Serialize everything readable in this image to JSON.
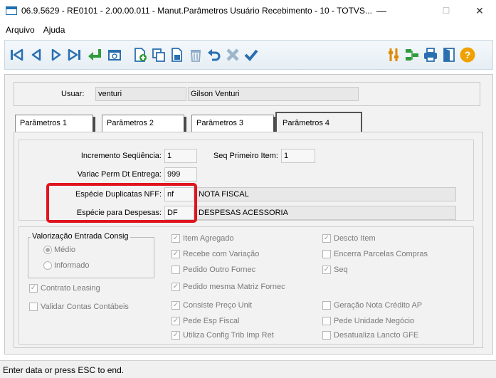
{
  "window": {
    "title": "06.9.5629 - RE0101 - 2.00.00.011 - Manut.Parâmetros Usuário Recebimento - 10 - TOTVS...",
    "minimize": "—",
    "maximize": "☐",
    "close": "✕"
  },
  "menu": [
    "Arquivo",
    "Ajuda"
  ],
  "toolbar": {
    "icons": [
      "first-record-icon",
      "previous-record-icon",
      "next-record-icon",
      "last-record-icon",
      "goto-icon",
      "search-icon",
      "add-icon",
      "copy-icon",
      "edit-icon",
      "delete-icon",
      "undo-icon",
      "cancel-icon",
      "confirm-icon",
      "tools-icon",
      "query-icon",
      "print-icon",
      "exit-icon",
      "help-icon"
    ],
    "help_glyph": "?"
  },
  "user": {
    "label": "Usuar:",
    "code": "venturi",
    "name": "Gilson Venturi"
  },
  "tabs": [
    "Parâmetros 1",
    "Parâmetros 2",
    "Parâmetros 3",
    "Parâmetros 4"
  ],
  "active_tab": "Parâmetros 4",
  "params": {
    "incremento_label": "Incremento Seqüência:",
    "incremento_value": "1",
    "seq_primeiro_label": "Seq Primeiro Item:",
    "seq_primeiro_value": "1",
    "variac_label": "Variac Perm Dt Entrega:",
    "variac_value": "999",
    "especie_dup_label": "Espécie Duplicatas NFF:",
    "especie_dup_code": "nf",
    "especie_dup_desc": "NOTA FISCAL",
    "especie_desp_label": "Espécie para Despesas:",
    "especie_desp_code": "DF",
    "especie_desp_desc": "DESPESAS ACESSORIA"
  },
  "valorizacao": {
    "legend": "Valorização Entrada Consig",
    "options": [
      "Médio",
      "Informado"
    ],
    "selected": "Médio"
  },
  "checkboxes": {
    "contrato_leasing": {
      "label": "Contrato Leasing",
      "checked": true
    },
    "validar_contas": {
      "label": "Validar Contas Contábeis",
      "checked": false
    },
    "item_agregado": {
      "label": "Item Agregado",
      "checked": true
    },
    "recebe_variacao": {
      "label": "Recebe com Variação",
      "checked": true
    },
    "pedido_outro": {
      "label": "Pedido Outro Fornec",
      "checked": false
    },
    "pedido_mesma": {
      "label": "Pedido mesma Matriz Fornec",
      "checked": true
    },
    "consiste_preco": {
      "label": "Consiste Preço Unit",
      "checked": true
    },
    "pede_esp": {
      "label": "Pede Esp Fiscal",
      "checked": true
    },
    "utiliza_config": {
      "label": "Utiliza Config Trib Imp Ret",
      "checked": true
    },
    "descto_item": {
      "label": "Descto Item",
      "checked": true
    },
    "encerra_parcelas": {
      "label": "Encerra Parcelas Compras",
      "checked": false
    },
    "seq": {
      "label": "Seq",
      "checked": true
    },
    "geracao_nota": {
      "label": "Geração Nota Crédito AP",
      "checked": false
    },
    "pede_unidade": {
      "label": "Pede Unidade Negócio",
      "checked": false
    },
    "desatualiza": {
      "label": "Desatualiza Lancto GFE",
      "checked": false
    }
  },
  "check_glyph": "✓",
  "status": "Enter data or press ESC to end.",
  "colors": {
    "highlight_red": "#e0141e",
    "toolbar_blue": "#2a6fb0",
    "toolbar_green": "#2f9b3a",
    "help_orange": "#f0a000"
  }
}
